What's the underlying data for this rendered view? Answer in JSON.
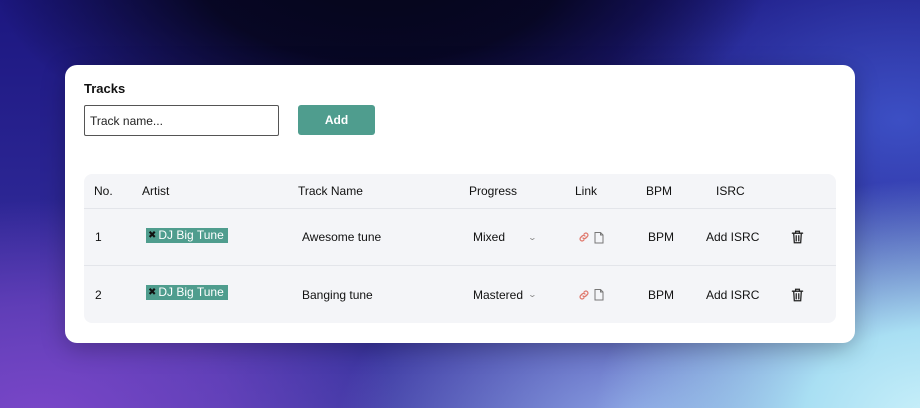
{
  "card": {
    "title": "Tracks",
    "input_placeholder": "Track name...",
    "add_label": "Add"
  },
  "table": {
    "headers": [
      "No.",
      "Artist",
      "Track Name",
      "Progress",
      "Link",
      "BPM",
      "ISRC"
    ],
    "rows": [
      {
        "no": "1",
        "artist": "DJ Big Tune",
        "track": "Awesome tune",
        "progress": "Mixed",
        "bpm": "BPM",
        "isrc": "Add ISRC"
      },
      {
        "no": "2",
        "artist": "DJ Big Tune",
        "track": "Banging tune",
        "progress": "Mastered",
        "bpm": "BPM",
        "isrc": "Add ISRC"
      }
    ]
  },
  "icons": {
    "tag_remove": "close-icon",
    "link": "link-icon",
    "copy": "copy-icon",
    "delete": "trash-icon",
    "dropdown": "chevron-down-icon"
  },
  "colors": {
    "accent": "#4f9d8e",
    "link_icon": "#e07a6e",
    "table_bg": "#f4f5f8"
  }
}
